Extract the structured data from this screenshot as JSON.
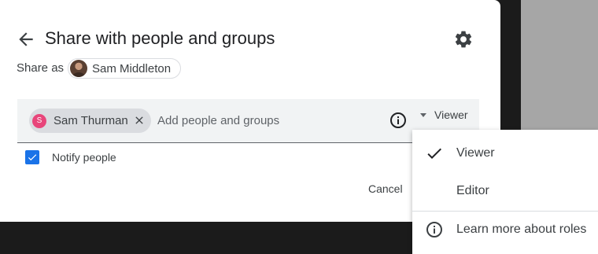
{
  "dialog": {
    "title": "Share with people and groups",
    "share_as_label": "Share as",
    "account_name": "Sam Middleton"
  },
  "recipients": [
    {
      "initial": "S",
      "name": "Sam Thurman",
      "color": "#e8457a"
    }
  ],
  "input": {
    "placeholder": "Add people and groups"
  },
  "role_dropdown": {
    "selected": "Viewer"
  },
  "notify": {
    "label": "Notify people",
    "checked": true
  },
  "actions": {
    "cancel_label": "Cancel"
  },
  "role_menu": {
    "items": [
      {
        "label": "Viewer",
        "checked": true,
        "icon": "check-icon"
      },
      {
        "label": "Editor",
        "checked": false
      },
      {
        "label": "Learn more about roles",
        "icon": "info-icon"
      }
    ]
  },
  "colors": {
    "accent": "#1a73e8",
    "text": "#3c4043",
    "field_bg": "#f1f3f4"
  }
}
